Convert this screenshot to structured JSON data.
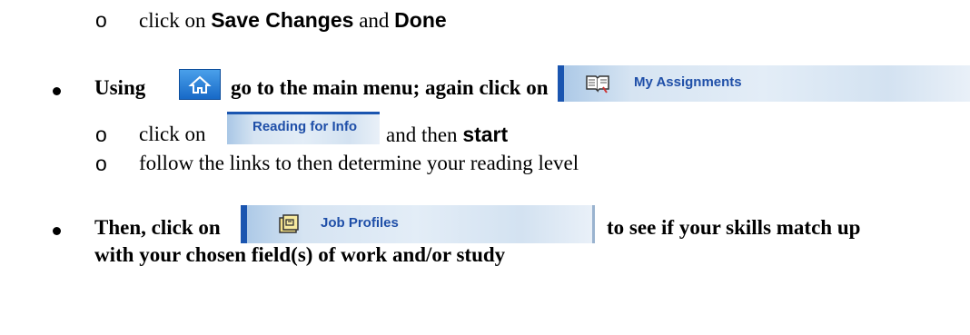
{
  "line1": {
    "prefix": "click on ",
    "save": "Save Changes",
    "and": " and ",
    "done": "Done"
  },
  "line2": {
    "using": "Using",
    "mid": "go to the main menu; again click on"
  },
  "buttons": {
    "my_assignments": "My Assignments",
    "reading_for_info": "Reading for Info",
    "job_profiles": "Job Profiles"
  },
  "line3": {
    "prefix": "click on",
    "and_then": "and then ",
    "start": "start"
  },
  "line4": "follow the links to then determine your reading level",
  "line5": {
    "then": "Then, click on",
    "suffix": "to see if your skills match up"
  },
  "line6": "with your chosen field(s) of work and/or study",
  "bullets": {
    "sub": "o"
  },
  "icons": [
    "home-icon",
    "book-icon",
    "folder-icon"
  ],
  "colors": {
    "button_text": "#1f4fa8",
    "home_button": "#1769c7",
    "edge_bar": "#1a55b0"
  }
}
